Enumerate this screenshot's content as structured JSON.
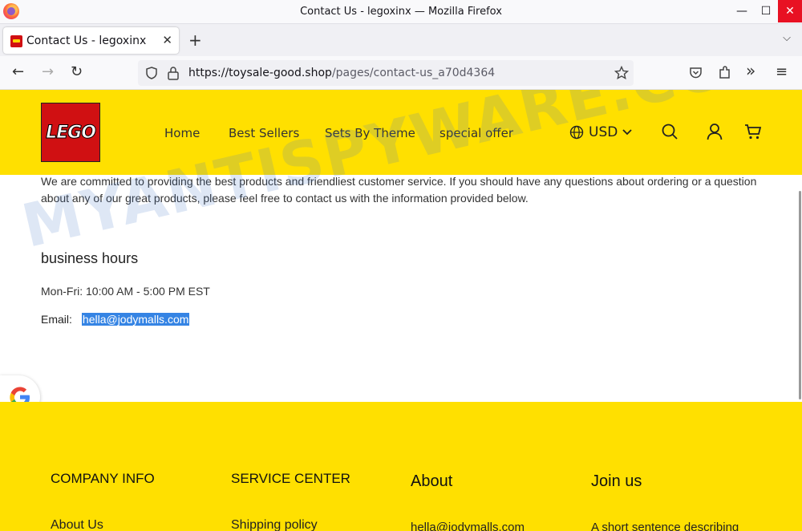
{
  "window": {
    "title": "Contact Us - legoxinx — Mozilla Firefox"
  },
  "tab": {
    "label": "Contact Us - legoxinx"
  },
  "url": {
    "domain": "https://toysale-good.shop",
    "path": "/pages/contact-us_a70d4364"
  },
  "header": {
    "logo_text": "LEGO",
    "nav": [
      "Home",
      "Best Sellers",
      "Sets By Theme",
      "special offer"
    ],
    "currency": "USD"
  },
  "content": {
    "intro": "We are committed to providing the best products and friendliest customer service. If you should have any questions about ordering or a question about any of our great products, please feel free to contact us with the information provided below.",
    "hours_heading": "business hours",
    "hours": "Mon-Fri: 10:00 AM - 5:00 PM EST",
    "email_label": "Email:",
    "email": "hella@jodymalls.com"
  },
  "footer": {
    "columns": [
      {
        "heading": "COMPANY INFO",
        "item": "About Us"
      },
      {
        "heading": "SERVICE CENTER",
        "item": "Shipping policy"
      },
      {
        "heading": "About",
        "item": "hella@jodymalls.com"
      },
      {
        "heading": "Join us",
        "item": "A short sentence describing"
      }
    ]
  },
  "watermark": "MYANTISPYWARE.COM",
  "colors": {
    "brand_yellow": "#ffe000",
    "lego_red": "#d01012",
    "selection": "#3584e4"
  }
}
